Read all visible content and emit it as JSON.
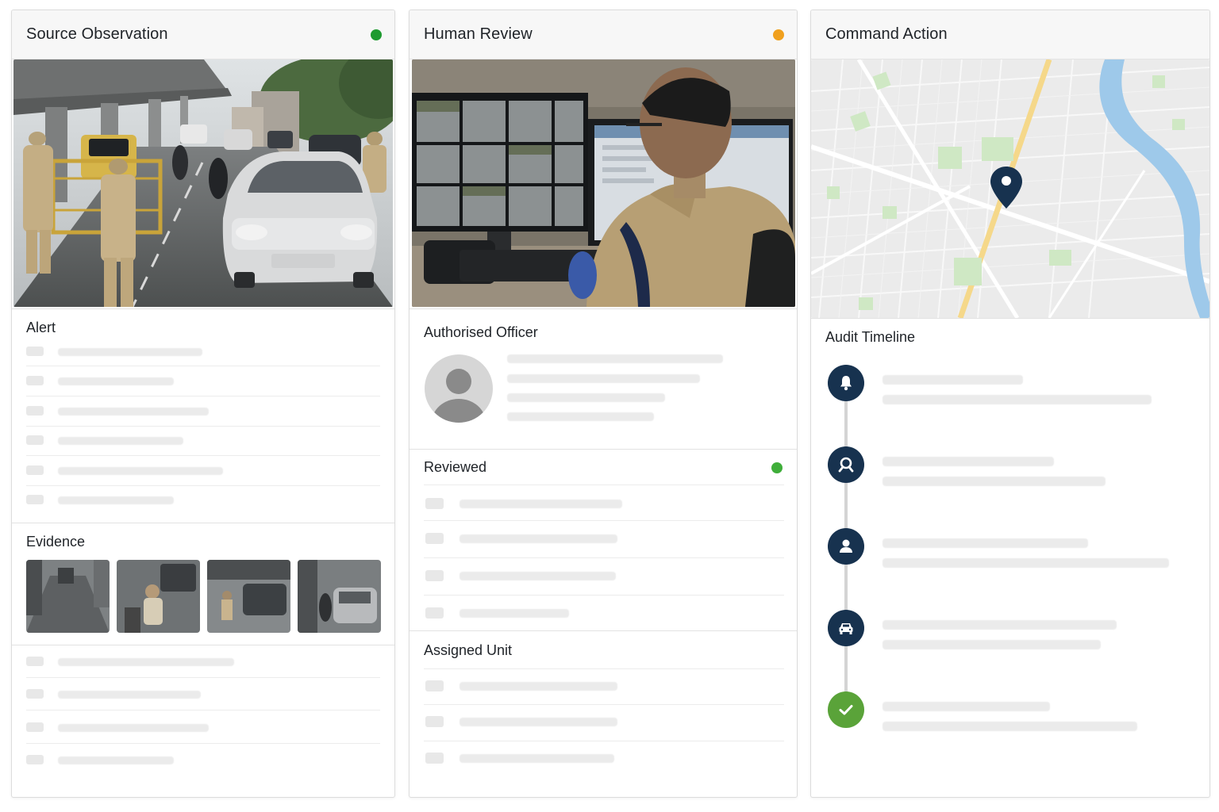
{
  "panels": {
    "source": {
      "title": "Source Observation",
      "status_color": "#1e9a2f"
    },
    "review": {
      "title": "Human Review",
      "status_color": "#f0a01e"
    },
    "command": {
      "title": "Command Action"
    }
  },
  "source_sections": {
    "alert": "Alert",
    "evidence": "Evidence"
  },
  "review_sections": {
    "officer": "Authorised Officer",
    "reviewed": "Reviewed",
    "reviewed_status_color": "#3fae3a",
    "assigned": "Assigned Unit"
  },
  "command_sections": {
    "audit": "Audit Timeline"
  },
  "timeline": [
    {
      "icon": "bell-icon",
      "color": "#17324f"
    },
    {
      "icon": "search-icon",
      "color": "#17324f"
    },
    {
      "icon": "user-icon",
      "color": "#17324f"
    },
    {
      "icon": "car-icon",
      "color": "#17324f"
    },
    {
      "icon": "check-icon",
      "color": "#5aa339"
    }
  ],
  "colors": {
    "accent_navy": "#17324f",
    "river": "#9ec9ea",
    "park": "#cfe8c4",
    "road_major": "#f5d88a"
  }
}
